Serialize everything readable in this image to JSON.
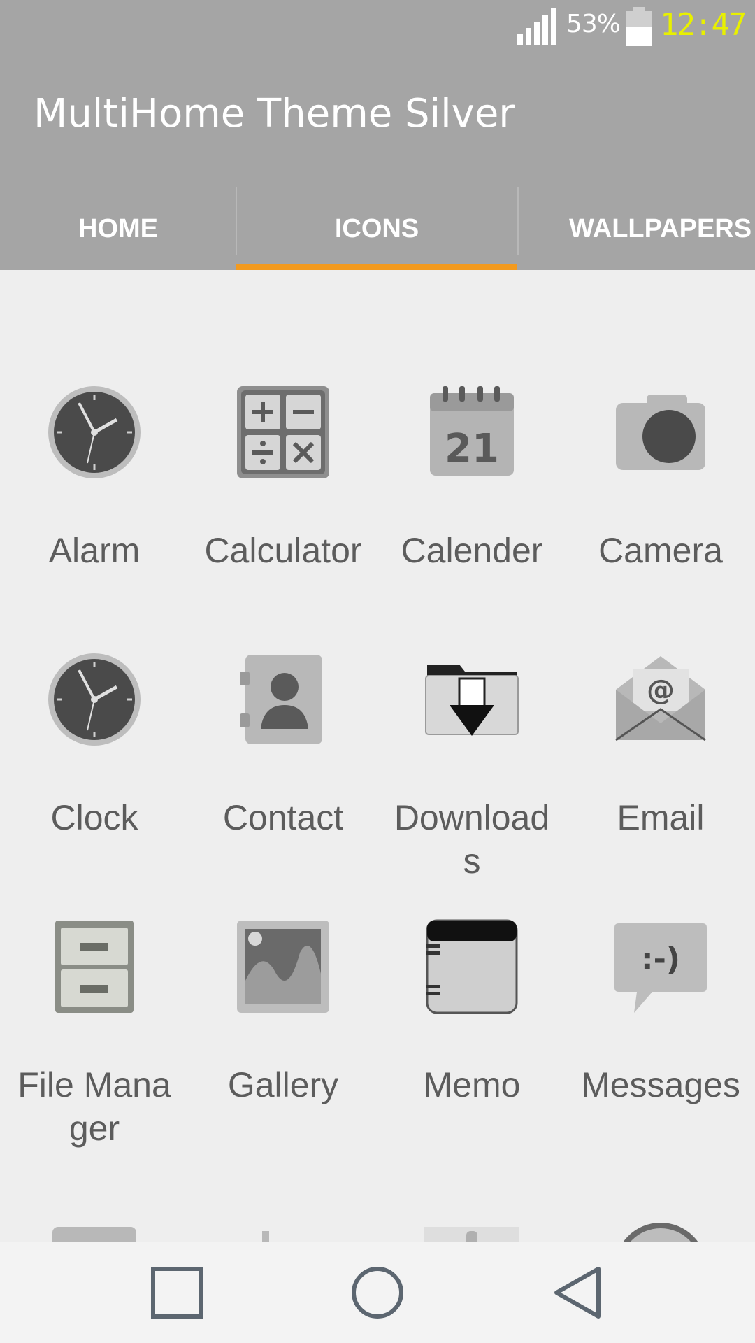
{
  "status_bar": {
    "battery_percent": "53%",
    "time": "12:47",
    "time_color": "#e8f000"
  },
  "app_bar": {
    "title": "MultiHome Theme Silver",
    "background": "#a5a5a5"
  },
  "tabs": [
    {
      "label": "HOME",
      "selected": false
    },
    {
      "label": "ICONS",
      "selected": true
    },
    {
      "label": "WALLPAPERS",
      "selected": false
    }
  ],
  "accent_color": "#f39a1e",
  "icons": [
    {
      "label": "Alarm",
      "icon": "alarm-clock-icon"
    },
    {
      "label": "Calculator",
      "icon": "calculator-icon"
    },
    {
      "label": "Calender",
      "icon": "calendar-icon",
      "date": "21"
    },
    {
      "label": "Camera",
      "icon": "camera-icon"
    },
    {
      "label": "Clock",
      "icon": "clock-icon"
    },
    {
      "label": "Contact",
      "icon": "contact-book-icon"
    },
    {
      "label": "Downloads",
      "icon": "download-icon"
    },
    {
      "label": "Email",
      "icon": "email-icon"
    },
    {
      "label": "File Manager",
      "icon": "file-cabinet-icon"
    },
    {
      "label": "Gallery",
      "icon": "gallery-icon"
    },
    {
      "label": "Memo",
      "icon": "memo-icon"
    },
    {
      "label": "Messages",
      "icon": "message-icon",
      "text": ":-)"
    }
  ],
  "nav_bar": {
    "buttons": [
      "recent-apps",
      "home",
      "back"
    ]
  }
}
